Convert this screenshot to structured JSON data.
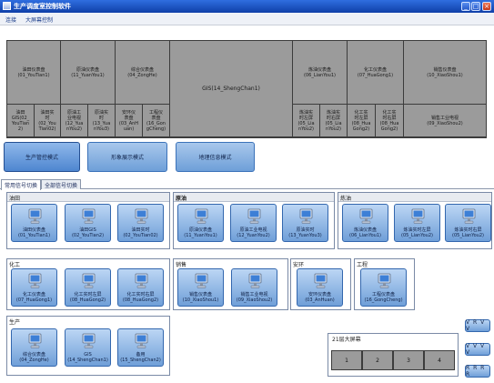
{
  "window": {
    "title": "生产调度室控制软件",
    "min_glyph": "_",
    "max_glyph": "□",
    "close_glyph": "×"
  },
  "menu": [
    "连接",
    "大屏幕控制"
  ],
  "top_table": {
    "headers": [
      "油田仪表盘\n(01_YouTian1)",
      "原油仪表盘\n(11_YuanYou1)",
      "综合仪表盘\n(04_ZongHe)",
      "GIS(14_ShengChan1)",
      "炼油仪表盘\n(06_LianYou1)",
      "化工仪表盘\n(07_HuaGong1)",
      "销售仪表盘\n(10_XiaoShou1)"
    ],
    "subs": [
      "油田\nGIS(02_\nYouTian\n2)",
      "油田实\n时\n(02_You\nTian02)",
      "原油工\n业电视\n(12_Yua\nnYou2)",
      "原油实\n时\n(13_Yua\nnYou3)",
      "安环仪\n表盘\n(03_AnH\nuan)",
      "工程仪\n表盘\n(16_Gon\ngCheng)",
      "炼油实\n时左屏\n(05_Lia\nnYou2)",
      "炼油实\n时右屏\n(05_Lia\nnYou2)",
      "化工实\n时左屏\n(08_Hua\nGong2)",
      "化工实\n时右屏\n(08_Hua\nGong2)",
      "销售工业电视\n(09_XiaoShou2)"
    ]
  },
  "modes": [
    "生产管控模式",
    "形象展示模式",
    "地理信息模式"
  ],
  "tabs": [
    "常用信号切换",
    "全部信号切换"
  ],
  "groups": {
    "youtian": {
      "label": "油田",
      "tiles": [
        "油田仪表盘\n(01_YouTian1)",
        "油田GIS\n(02_YouTian2)",
        "油田实时\n(02_YouTian02)"
      ]
    },
    "yuanyou": {
      "label": "原油",
      "tiles": [
        "原油仪表盘\n(11_YuanYou1)",
        "原油工业电视\n(12_YuanYou2)",
        "原油实时\n(13_YuanYou3)"
      ]
    },
    "lianyou": {
      "label": "炼油",
      "tiles": [
        "炼油仪表盘\n(06_LianYou1)",
        "炼油实时左屏\n(05_LianYou2)",
        "炼油实时右屏\n(05_LianYou2)"
      ]
    },
    "huagong": {
      "label": "化工",
      "tiles": [
        "化工仪表盘\n(07_HuaGong1)",
        "化工实时左屏\n(08_HuaGong2)",
        "化工实时右屏\n(08_HuaGong2)"
      ]
    },
    "xiaoshou": {
      "label": "销售",
      "tiles": [
        "销售仪表盘\n(10_XiaoShou1)",
        "销售工业电视\n(09_XiaoShou2)"
      ]
    },
    "anhuan": {
      "label": "安环",
      "tiles": [
        "安环仪表盘\n(03_AnHuan)"
      ]
    },
    "gongcheng": {
      "label": "工程",
      "tiles": [
        "工程仪表盘\n(16_GongCheng)"
      ]
    },
    "shengchan": {
      "label": "生产",
      "tiles": [
        "综合仪表盘\n(04_ZongHe)",
        "GIS\n(14_ShengChan1)",
        "备用\n(15_ShengChan2)"
      ]
    }
  },
  "bigscreen": {
    "label": "21层大屏幕",
    "cells": [
      "1",
      "2",
      "3",
      "4"
    ]
  },
  "side_buttons": [
    "V R V V",
    "V V V V",
    "R R R R"
  ]
}
